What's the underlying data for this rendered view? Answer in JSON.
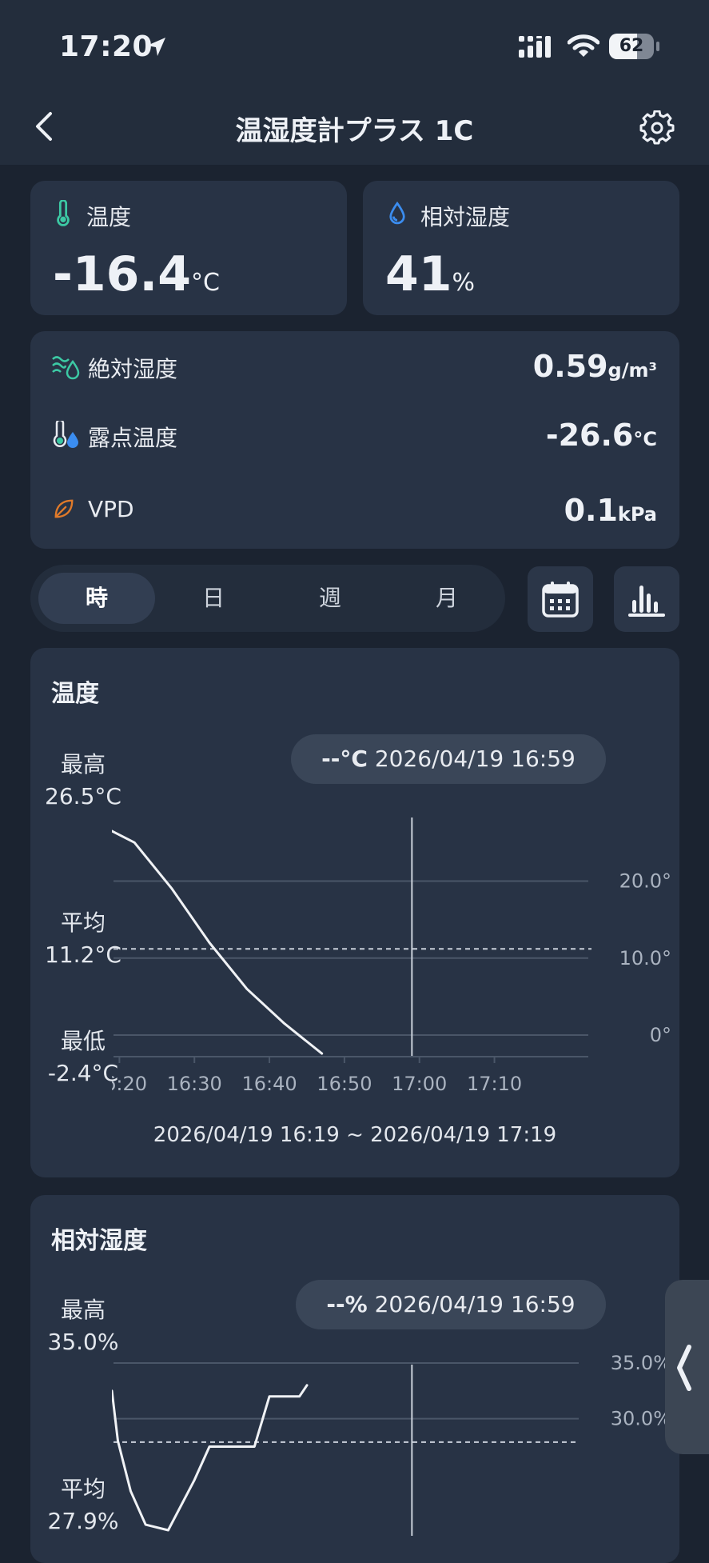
{
  "status_bar": {
    "time": "17:20",
    "battery": "62",
    "battery_level": 0.62
  },
  "header": {
    "title": "温湿度計プラス 1C",
    "back_icon": "chevron-left-icon",
    "settings_icon": "gear-icon"
  },
  "temperature_card": {
    "label": "温度",
    "value": "-16.4",
    "unit": "°C",
    "icon": "thermometer-icon",
    "icon_color": "#3cc9a4"
  },
  "humidity_card": {
    "label": "相対湿度",
    "value": "41",
    "unit": "%",
    "icon": "water-drop-icon",
    "icon_color": "#3b8df0"
  },
  "metrics": [
    {
      "label": "絶対湿度",
      "value": "0.59",
      "unit": "g/m³",
      "icon": "waves-drop-icon"
    },
    {
      "label": "露点温度",
      "value": "-26.6",
      "unit": "°C",
      "icon": "dew-point-icon"
    },
    {
      "label": "VPD",
      "value": "0.1",
      "unit": "kPa",
      "icon": "leaf-icon"
    }
  ],
  "period_tabs": [
    {
      "label": "時",
      "active": true
    },
    {
      "label": "日",
      "active": false
    },
    {
      "label": "週",
      "active": false
    },
    {
      "label": "月",
      "active": false
    }
  ],
  "toolbar": {
    "calendar_icon": "calendar-icon",
    "chart_icon": "bar-chart-icon"
  },
  "temp_chart": {
    "title": "温度",
    "max_label": "最高",
    "max_value": "26.5°C",
    "avg_label": "平均",
    "avg_value": "11.2°C",
    "min_label": "最低",
    "min_value": "-2.4°C",
    "cursor_value": "--°C",
    "cursor_time": "2026/04/19 16:59",
    "range": "2026/04/19 16:19 ~ 2026/04/19 17:19"
  },
  "humidity_chart": {
    "title": "相対湿度",
    "max_label": "最高",
    "max_value": "35.0%",
    "avg_label": "平均",
    "avg_value": "27.9%",
    "cursor_value": "--%",
    "cursor_time": "2026/04/19 16:59"
  },
  "chart_data": [
    {
      "type": "line",
      "title": "温度",
      "x_ticks": [
        "16:20",
        "16:30",
        "16:40",
        "16:50",
        "17:00",
        "17:10"
      ],
      "y_ticks": [
        "20.0°",
        "10.0°",
        "0°"
      ],
      "ylim": [
        -2.8,
        29.5
      ],
      "xlim_minutes": [
        19,
        79
      ],
      "series": [
        {
          "x": [
            19,
            22,
            27,
            32,
            37,
            42,
            47
          ],
          "y": [
            26.5,
            25,
            19,
            12,
            6,
            1.5,
            -2.4
          ]
        }
      ],
      "average": 11.2,
      "cursor_x": 59,
      "grid": true
    },
    {
      "type": "line",
      "title": "相対湿度",
      "y_ticks": [
        "35.0%",
        "30.0%"
      ],
      "ylim": [
        19.5,
        36
      ],
      "xlim_minutes": [
        19,
        79
      ],
      "series": [
        {
          "x": [
            19,
            19.8,
            21.5,
            23.5,
            26.5,
            30,
            32,
            38,
            40,
            42.5,
            44,
            45
          ],
          "y": [
            32.5,
            28,
            23.5,
            20.5,
            20,
            24.5,
            27.5,
            27.5,
            32,
            32,
            32,
            33
          ]
        }
      ],
      "average": 27.9,
      "cursor_x": 59,
      "grid": true
    }
  ]
}
